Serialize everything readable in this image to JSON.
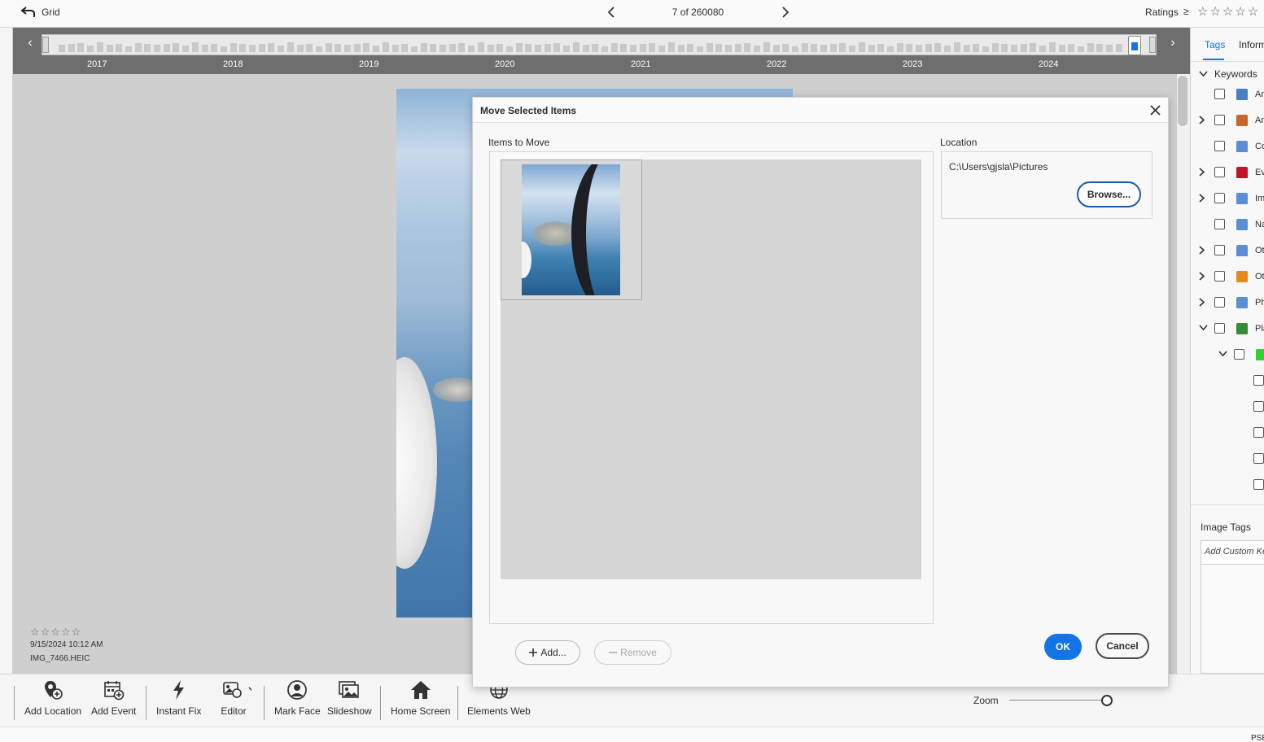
{
  "topbar": {
    "back_label": "Grid",
    "counter": "7 of 260080",
    "ratings_label": "Ratings",
    "ratings_operator": "≥",
    "stars": [
      "☆",
      "☆",
      "☆",
      "☆",
      "☆"
    ]
  },
  "timeline": {
    "years": [
      "2017",
      "2018",
      "2019",
      "2020",
      "2021",
      "2022",
      "2023",
      "2024"
    ],
    "prev": "‹",
    "next": "›"
  },
  "photo": {
    "rating_stars": "☆☆☆☆☆",
    "date": "9/15/2024 10:12 AM",
    "filename": "IMG_7466.HEIC"
  },
  "right_panel": {
    "tabs": [
      "Tags",
      "Inform"
    ],
    "keywords_label": "Keywords",
    "keyword_items": [
      {
        "text": "An",
        "icon_color": "#4a7fc1",
        "icon": "house-icon",
        "expandable": false
      },
      {
        "text": "An",
        "icon_color": "#c4682e",
        "icon": "animal-icon",
        "expandable": true
      },
      {
        "text": "Co",
        "icon_color": "#5b8fd3",
        "icon": "tag-icon",
        "expandable": false
      },
      {
        "text": "Ev",
        "icon_color": "#c0142b",
        "icon": "event-icon",
        "expandable": true
      },
      {
        "text": "Im",
        "icon_color": "#5b8fd3",
        "icon": "tag-icon",
        "expandable": true
      },
      {
        "text": "Na",
        "icon_color": "#5b8fd3",
        "icon": "tag-icon",
        "expandable": false
      },
      {
        "text": "Ot",
        "icon_color": "#5b8fd3",
        "icon": "tag-icon",
        "expandable": true
      },
      {
        "text": "Ot",
        "icon_color": "#e58a1f",
        "icon": "other-icon",
        "expandable": true
      },
      {
        "text": "Ph",
        "icon_color": "#5b8fd3",
        "icon": "tag-icon",
        "expandable": true
      },
      {
        "text": "Pla",
        "icon_color": "#3a8a3a",
        "icon": "palm-icon",
        "expandable": true,
        "expanded": true
      }
    ],
    "image_tags_label": "Image Tags",
    "custom_keyword_placeholder": "Add Custom Ke"
  },
  "toolbar": {
    "buttons": [
      {
        "label": "Add Location",
        "icon": "location-add-icon"
      },
      {
        "label": "Add Event",
        "icon": "calendar-add-icon"
      },
      {
        "label": "Instant Fix",
        "icon": "lightning-icon"
      },
      {
        "label": "Editor",
        "icon": "editor-icon"
      },
      {
        "label": "Mark Face",
        "icon": "face-icon"
      },
      {
        "label": "Slideshow",
        "icon": "slideshow-icon"
      },
      {
        "label": "Home Screen",
        "icon": "home-icon"
      },
      {
        "label": "Elements Web",
        "icon": "globe-icon"
      }
    ],
    "zoom_label": "Zoom"
  },
  "status": {
    "text": "PSE"
  },
  "dialog": {
    "title": "Move Selected Items",
    "items_label": "Items to Move",
    "location_label": "Location",
    "location_path": "C:\\Users\\gjsla\\Pictures",
    "browse_label": "Browse...",
    "add_label": "Add...",
    "remove_label": "Remove",
    "ok_label": "OK",
    "cancel_label": "Cancel"
  },
  "colors": {
    "accent": "#1473e6",
    "timeline_bg": "#6e6e6e",
    "viewer_bg": "#cfcfcf"
  }
}
